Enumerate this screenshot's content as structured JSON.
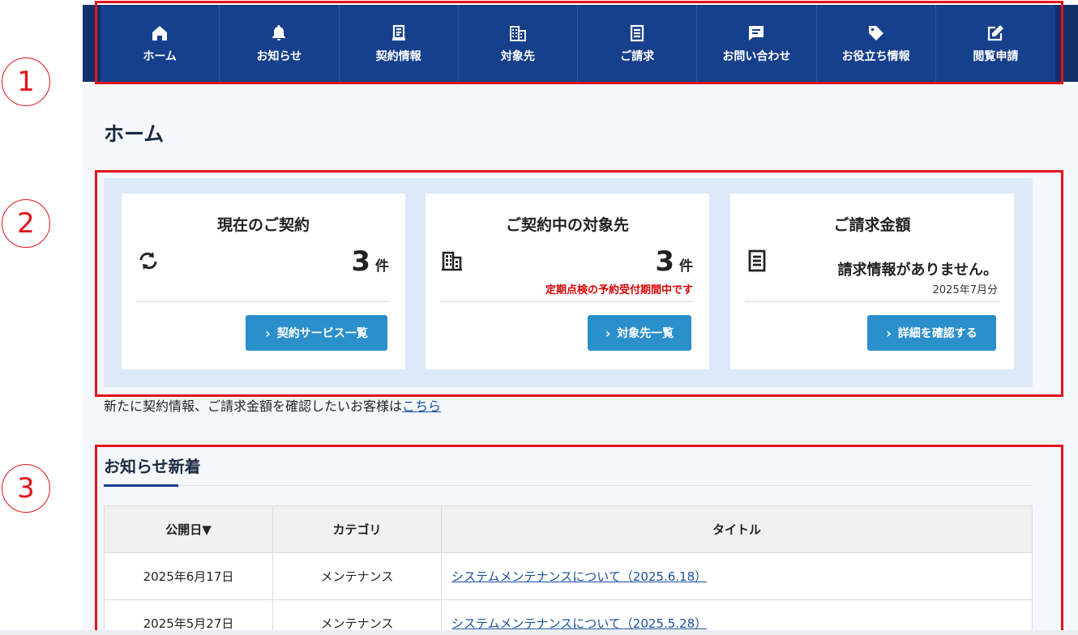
{
  "nav": {
    "items": [
      {
        "label": "ホーム",
        "icon": "home-icon"
      },
      {
        "label": "お知らせ",
        "icon": "bell-icon"
      },
      {
        "label": "契約情報",
        "icon": "document-icon"
      },
      {
        "label": "対象先",
        "icon": "building-icon"
      },
      {
        "label": "ご請求",
        "icon": "receipt-icon"
      },
      {
        "label": "お問い合わせ",
        "icon": "chat-icon"
      },
      {
        "label": "お役立ち情報",
        "icon": "tag-icon"
      },
      {
        "label": "閲覧申請",
        "icon": "edit-icon"
      }
    ]
  },
  "annotations": {
    "marker1": "1",
    "marker2": "2",
    "marker3": "3"
  },
  "page": {
    "title": "ホーム"
  },
  "cards": {
    "contract": {
      "title": "現在のご契約",
      "count": "3",
      "unit": "件",
      "button": "契約サービス一覧"
    },
    "targets": {
      "title": "ご契約中の対象先",
      "count": "3",
      "unit": "件",
      "note": "定期点検の予約受付期間中です",
      "button": "対象先一覧"
    },
    "billing": {
      "title": "ご請求金額",
      "message": "請求情報がありません。",
      "period": "2025年7月分",
      "button": "詳細を確認する"
    }
  },
  "notice": {
    "text": "新たに契約情報、ご請求金額を確認したいお客様は",
    "link": "こちら"
  },
  "news": {
    "title": "お知らせ新着",
    "headers": {
      "date": "公開日▼",
      "category": "カテゴリ",
      "title": "タイトル"
    },
    "rows": [
      {
        "date": "2025年6月17日",
        "category": "メンテナンス",
        "title": "システムメンテナンスについて（2025.6.18）"
      },
      {
        "date": "2025年5月27日",
        "category": "メンテナンス",
        "title": "システムメンテナンスについて（2025.5.28）"
      }
    ]
  },
  "colors": {
    "nav": "#163f8c",
    "button": "#2b8fcb",
    "annotation": "#e3141b",
    "alert": "#d60000"
  }
}
